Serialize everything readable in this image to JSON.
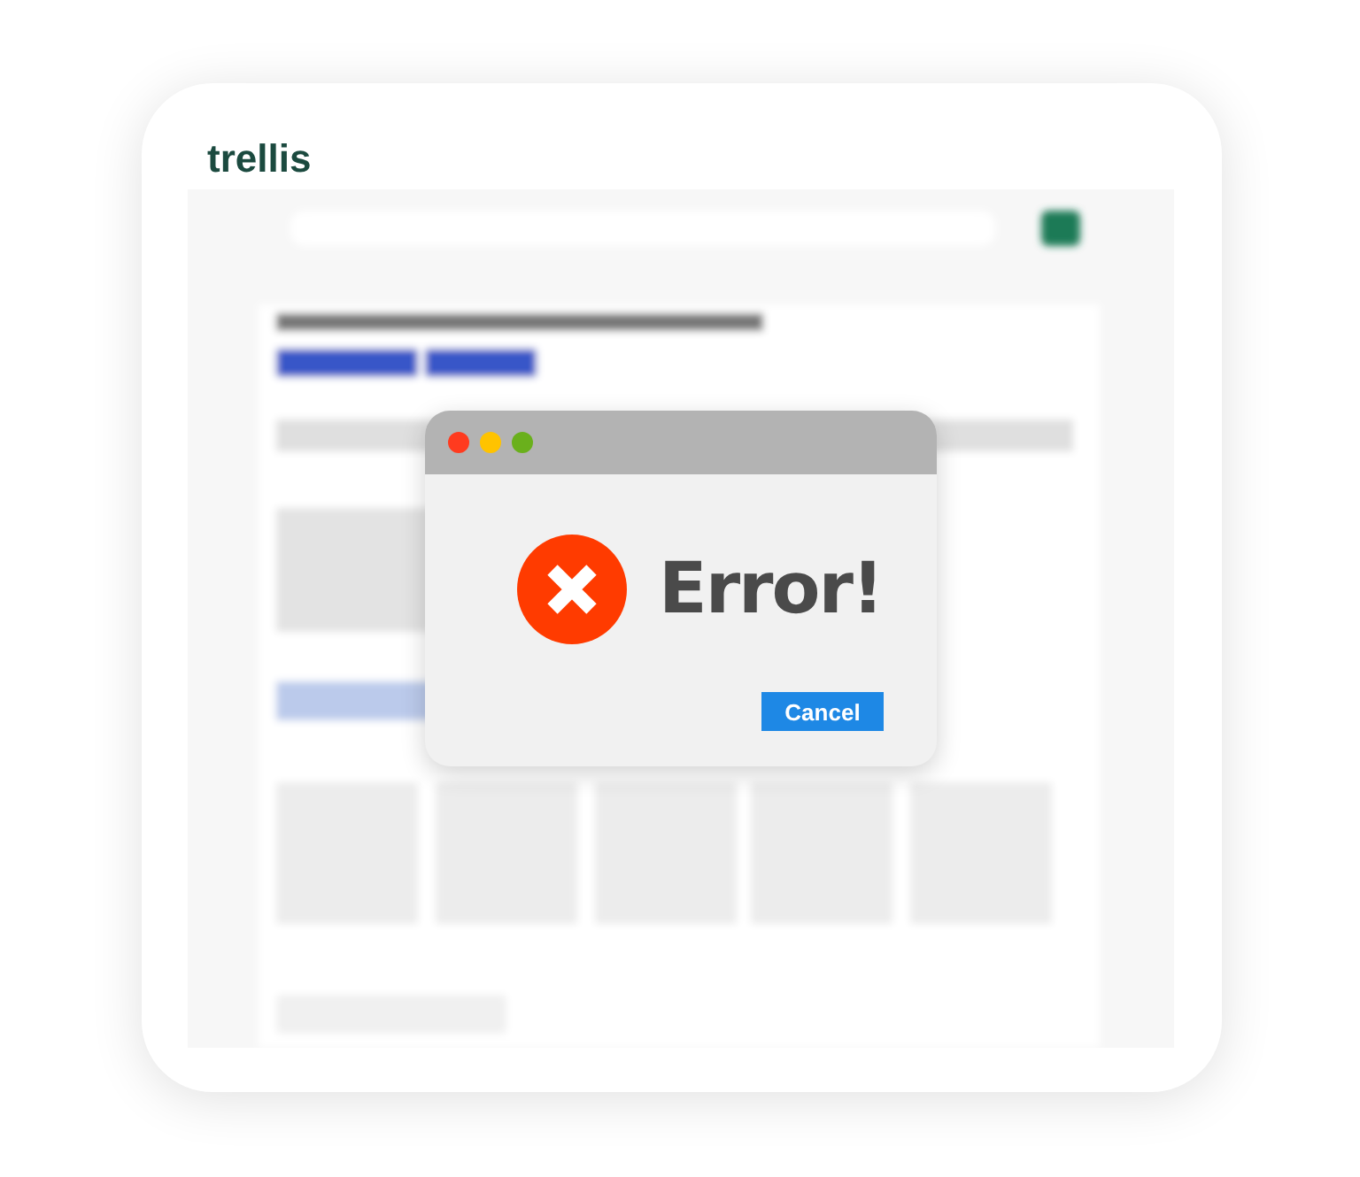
{
  "logo": "trellis",
  "dialog": {
    "message": "Error!",
    "buttons": [
      "Cancel"
    ]
  }
}
